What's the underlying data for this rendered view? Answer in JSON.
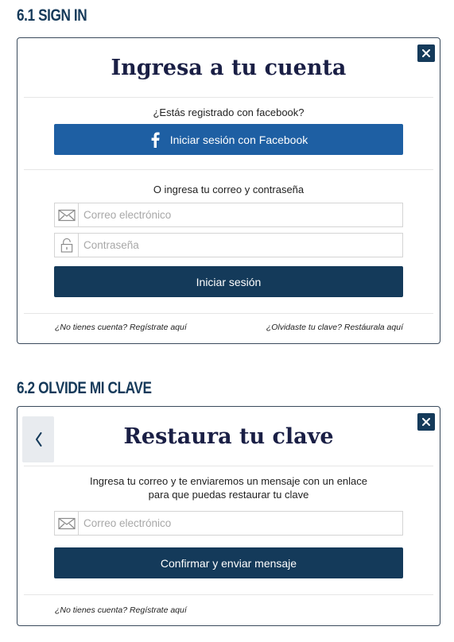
{
  "signin": {
    "section_title": "6.1 SIGN IN",
    "heading": "Ingresa a tu cuenta",
    "facebook_prompt": "¿Estás registrado con facebook?",
    "facebook_button": "Iniciar sesión con Facebook",
    "email_prompt": "O ingresa tu correo y contraseña",
    "email_placeholder": "Correo electrónico",
    "password_placeholder": "Contraseña",
    "submit_button": "Iniciar sesión",
    "register_link": "¿No tienes cuenta? Regístrate aquí",
    "forgot_link": "¿Olvidaste tu clave? Restáurala aquí"
  },
  "forgot": {
    "section_title": "6.2 OLVIDE MI CLAVE",
    "heading": "Restaura tu clave",
    "instruction_line1": "Ingresa tu correo y te enviaremos un mensaje con un enlace",
    "instruction_line2": "para que puedas restaurar tu clave",
    "email_placeholder": "Correo electrónico",
    "submit_button": "Confirmar y enviar mensaje",
    "register_link": "¿No tienes cuenta? Regístrate aquí"
  },
  "icons": {
    "close": "close-icon",
    "back": "chevron-left-icon",
    "facebook": "facebook-icon",
    "email": "envelope-icon",
    "password": "lock-icon"
  },
  "colors": {
    "navy": "#143a5a",
    "facebook_blue": "#1e5fa3",
    "heading": "#1a1f45"
  }
}
